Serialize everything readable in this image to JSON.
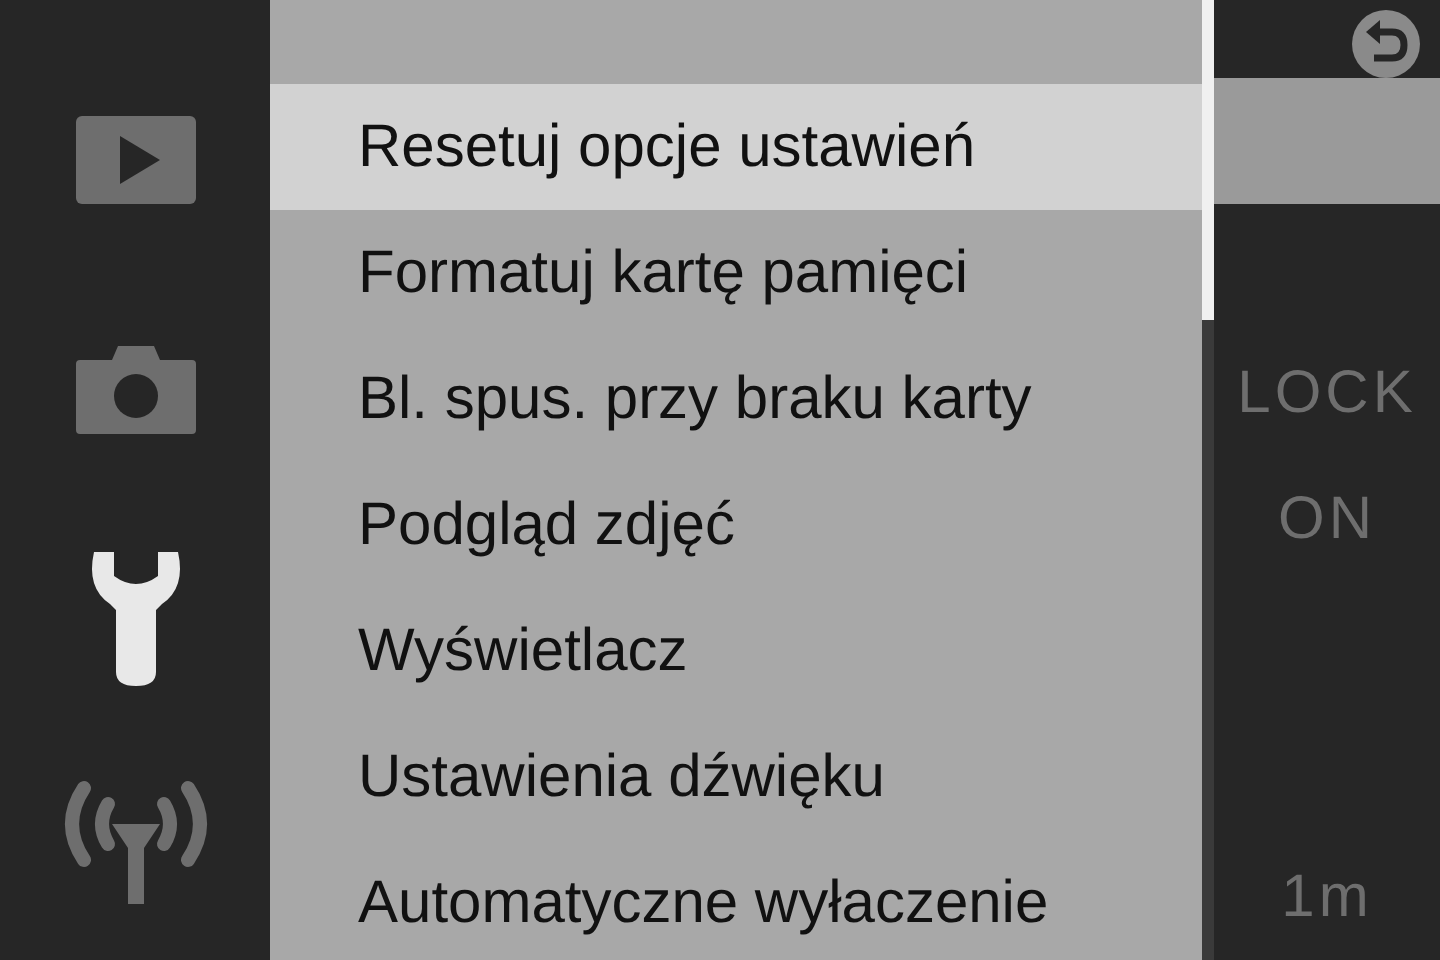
{
  "sidebar": {
    "tabs": [
      {
        "kind": "playback",
        "selected": false
      },
      {
        "kind": "camera",
        "selected": false
      },
      {
        "kind": "setup",
        "selected": true
      },
      {
        "kind": "wireless",
        "selected": false
      }
    ]
  },
  "menu": {
    "items": [
      {
        "label": "Resetuj opcje ustawień",
        "selected": true
      },
      {
        "label": "Formatuj kartę pamięci",
        "selected": false
      },
      {
        "label": "Bl. spus. przy braku karty",
        "value": "LOCK",
        "selected": false
      },
      {
        "label": "Podgląd zdjęć",
        "value": "ON",
        "selected": false
      },
      {
        "label": "Wyświetlacz",
        "selected": false
      },
      {
        "label": "Ustawienia dźwięku",
        "selected": false
      },
      {
        "label": "Automatyczne wyłaczenie",
        "value": "1m",
        "selected": false
      }
    ]
  }
}
